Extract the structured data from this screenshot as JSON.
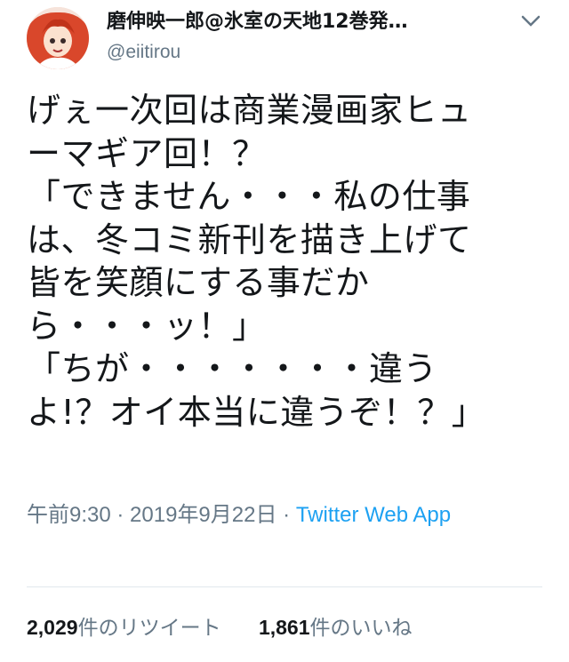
{
  "user": {
    "display_name": "磨伸映一郎@氷室の天地12巻発…",
    "handle": "@eiitirou"
  },
  "tweet": {
    "text": "げぇ一次回は商業漫画家ヒュ\nーマギア回！？\n「できません・・・私の仕事\nは、冬コミ新刊を描き上げて\n皆を笑顔にする事だか\nら・・・ッ！」\n「ちが・・・・・・・違う\nよ!？オイ本当に違うぞ！？」"
  },
  "meta": {
    "time": "午前9:30",
    "separator": " · ",
    "date": "2019年9月22日",
    "separator2": " · ",
    "source": "Twitter Web App"
  },
  "stats": {
    "retweets_count": "2,029",
    "retweets_label": "件のリツイート",
    "likes_count": "1,861",
    "likes_label": "件のいいね"
  },
  "icons": {
    "menu": "chevron-down-icon"
  },
  "colors": {
    "link": "#1da1f2",
    "secondary": "#657786"
  }
}
